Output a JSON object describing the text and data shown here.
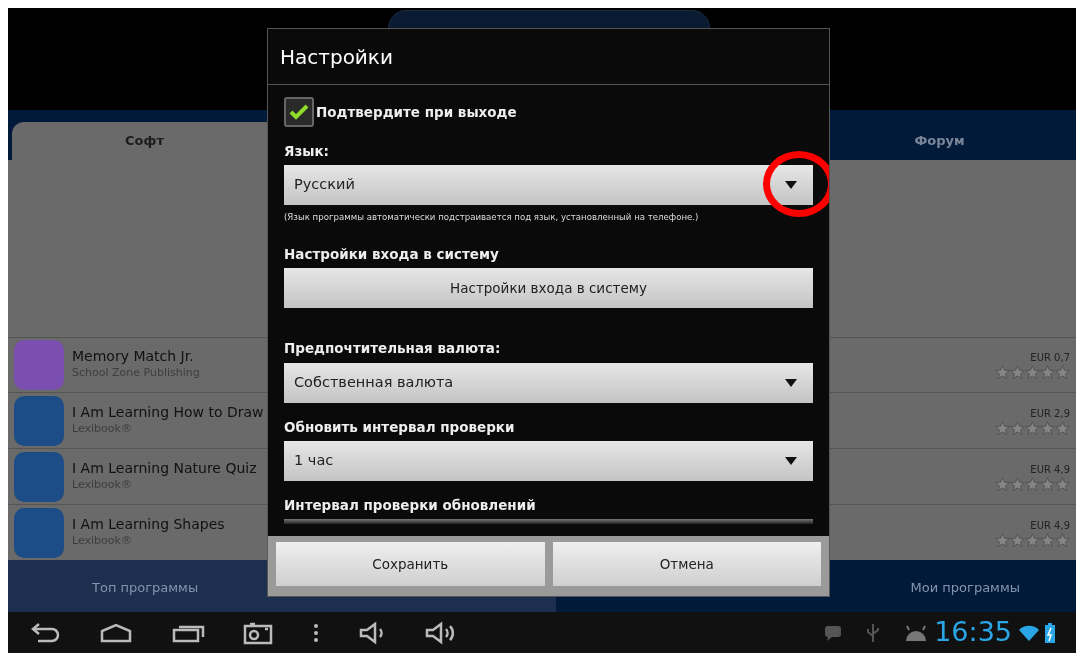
{
  "app": {
    "tabs": [
      {
        "label": "Софт",
        "selected": true
      },
      {
        "label": "Форум",
        "selected": false
      }
    ],
    "apps": [
      {
        "title": "Memory Match Jr.",
        "publisher": "School Zone Publishing",
        "price": "EUR 0,7",
        "stars": 0,
        "color": "#7b4fb0"
      },
      {
        "title": "I Am Learning How to Draw",
        "publisher": "Lexibook®",
        "price": "EUR 2,9",
        "stars": 0,
        "color": "#1d4d86"
      },
      {
        "title": "I Am Learning Nature Quiz",
        "publisher": "Lexibook®",
        "price": "EUR 4,9",
        "stars": 0,
        "color": "#1d4d86"
      },
      {
        "title": "I Am Learning Shapes",
        "publisher": "Lexibook®",
        "price": "EUR 4,9",
        "stars": 0,
        "color": "#1d4d86"
      }
    ],
    "bottom_tabs": [
      {
        "label": "Топ программы",
        "selected": true
      },
      {
        "label": "Мои программы",
        "selected": false
      }
    ]
  },
  "dialog": {
    "title": "Настройки",
    "items": [
      {
        "kind": "checkbox",
        "label": "Подтвердите при выходе",
        "checked": true
      },
      {
        "kind": "label",
        "text": "Язык:"
      },
      {
        "kind": "select",
        "value": "Русский",
        "highlighted": true
      },
      {
        "kind": "hint",
        "text": "(Язык программы автоматически подстраивается под язык, установленный на телефоне.)"
      },
      {
        "kind": "label",
        "text": "Настройки входа в систему"
      },
      {
        "kind": "button",
        "text": "Настройки входа в систему"
      },
      {
        "kind": "label",
        "text": "Предпочтительная валюта:"
      },
      {
        "kind": "select",
        "value": "Собственная валюта",
        "highlighted": false
      },
      {
        "kind": "label",
        "text": "Обновить интервал проверки"
      },
      {
        "kind": "select",
        "value": "1 час",
        "highlighted": false
      },
      {
        "kind": "label",
        "text": "Интервал проверки обновлений"
      },
      {
        "kind": "partial"
      }
    ],
    "buttons": [
      "Сохранить",
      "Отмена"
    ]
  },
  "status_bar": {
    "time": "16:35"
  }
}
